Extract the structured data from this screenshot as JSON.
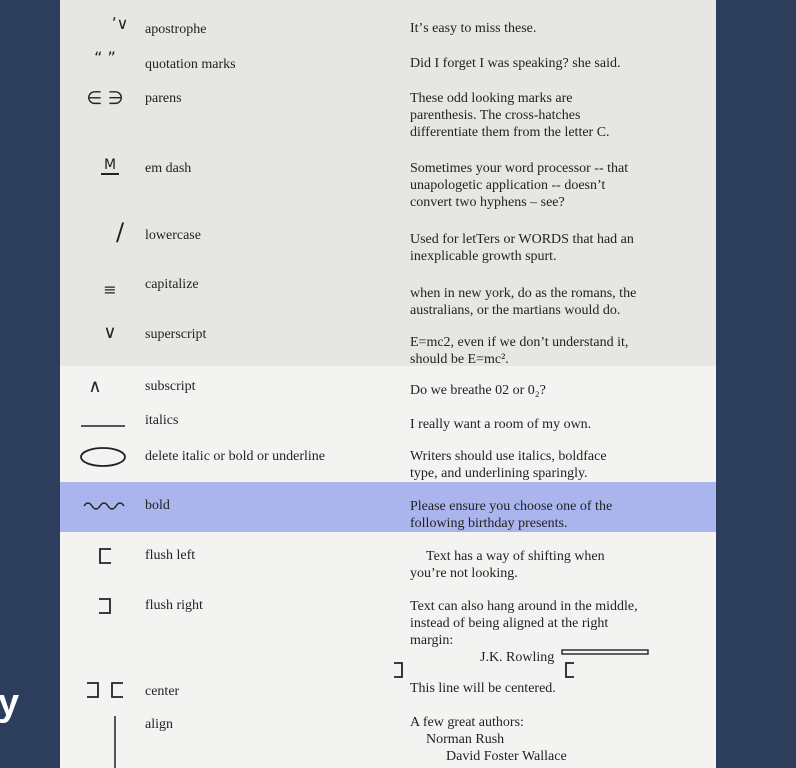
{
  "background": {
    "title_fragment": "y"
  },
  "rows": [
    {
      "name": "apostrophe",
      "symbol": "ʼ∨",
      "symbol_icon": "apostrophe-caret-icon",
      "example": [
        "Itʼs easy to miss these."
      ]
    },
    {
      "name": "quotation marks",
      "symbol": "“ ”",
      "symbol_icon": "quotation-caret-icon",
      "example": [
        "Did I forget I was speaking? she said."
      ]
    },
    {
      "name": "parens",
      "symbol": "∈ ∋",
      "symbol_icon": "parens-mark-icon",
      "example": [
        "These odd looking marks are",
        "parenthesis. The cross-hatches",
        "differentiate them from the letter C."
      ]
    },
    {
      "name": "em dash",
      "symbol": "M",
      "symbol_icon": "em-dash-mark-icon",
      "example": [
        "Sometimes your word processor -- that",
        "unapologetic application -- doesn’t",
        "convert two hyphens – see?"
      ]
    },
    {
      "name": "lowercase",
      "symbol": "/",
      "symbol_icon": "slash-mark-icon",
      "example": [
        "Used for letTers or WORDS that had an",
        "inexplicable growth spurt."
      ]
    },
    {
      "name": "capitalize",
      "symbol": "≡",
      "symbol_icon": "triple-underline-icon",
      "example": [
        "when in new york, do as the romans, the",
        "australians, or the martians would do."
      ]
    },
    {
      "name": "superscript",
      "symbol": "∨",
      "symbol_icon": "superscript-caret-icon",
      "example": [
        "E=mc2, even if we don’t understand it,",
        "should be E=mc²."
      ]
    },
    {
      "name": "subscript",
      "symbol": "∧",
      "symbol_icon": "subscript-caret-icon",
      "example": [
        "Do we breathe 02 or 0₂?"
      ]
    },
    {
      "name": "italics",
      "symbol": "",
      "symbol_icon": "underline-icon",
      "example": [
        "I really want a room of my own."
      ]
    },
    {
      "name": "delete italic or bold or underline",
      "symbol": "",
      "symbol_icon": "oval-icon",
      "example": [
        "Writers should use italics, boldface",
        "type, and underlining sparingly."
      ]
    },
    {
      "name": "bold",
      "symbol": "",
      "symbol_icon": "wavy-underline-icon",
      "example": [
        "Please ensure you choose one of the",
        "following birthday presents."
      ]
    },
    {
      "name": "flush left",
      "symbol": "",
      "symbol_icon": "bracket-left-icon",
      "example": [
        "Text has a way of shifting when",
        "you’re not looking."
      ]
    },
    {
      "name": "flush right",
      "symbol": "",
      "symbol_icon": "bracket-right-icon",
      "example": [
        "Text can also hang around in the middle,",
        "instead of being aligned at the right",
        "margin:",
        "J.K. Rowling"
      ]
    },
    {
      "name": "center",
      "symbol": "",
      "symbol_icon": "center-brackets-icon",
      "example": [
        "This line will be centered."
      ]
    },
    {
      "name": "align",
      "symbol": "",
      "symbol_icon": "vertical-line-icon",
      "example": [
        "A few great authors:",
        "Norman Rush",
        "David Foster Wallace"
      ]
    }
  ]
}
